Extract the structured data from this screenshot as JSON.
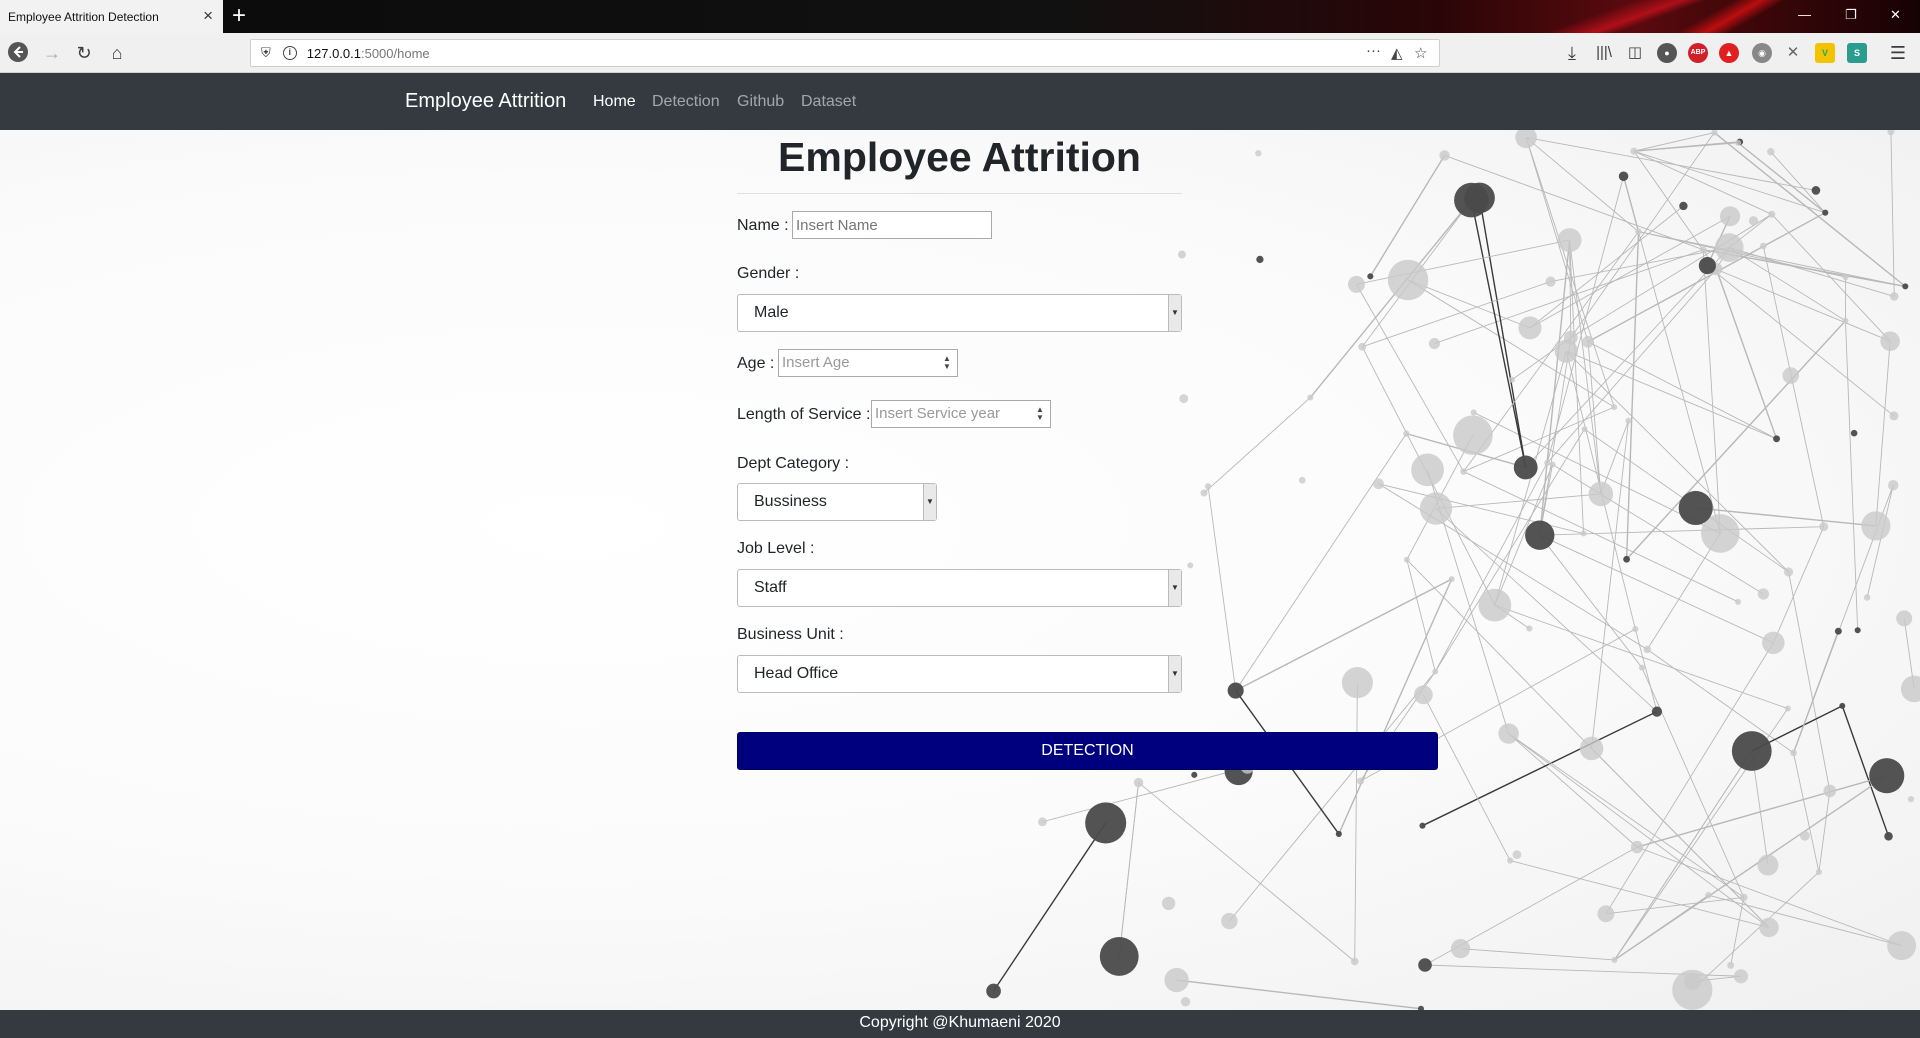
{
  "browser": {
    "tab_title": "Employee Attrition Detection",
    "tab_close": "×",
    "new_tab": "+",
    "url_host": "127.0.0.1",
    "url_path": ":5000/home",
    "icons": [
      "back-icon",
      "forward-icon",
      "reload-icon",
      "home-icon",
      "shield-icon",
      "info-icon",
      "more-icon",
      "pocket-icon",
      "bookmark-star-icon",
      "download-icon",
      "library-icon",
      "sidebar-icon",
      "account-icon",
      "adblock-icon",
      "extension-icon"
    ]
  },
  "site": {
    "brand": "Employee Attrition",
    "nav": [
      {
        "label": "Home",
        "active": true
      },
      {
        "label": "Detection",
        "active": false
      },
      {
        "label": "Github",
        "active": false
      },
      {
        "label": "Dataset",
        "active": false
      }
    ]
  },
  "form": {
    "title": "Employee Attrition",
    "name_label": "Name :",
    "name_placeholder": "Insert Name",
    "gender_label": "Gender :",
    "gender_value": "Male",
    "age_label": "Age :",
    "age_placeholder": "Insert Age",
    "service_label": "Length of Service :",
    "service_placeholder": "Insert Service year",
    "dept_label": "Dept Category :",
    "dept_value": "Bussiness",
    "job_label": "Job Level :",
    "job_value": "Staff",
    "unit_label": "Business Unit :",
    "unit_value": "Head Office",
    "submit_label": "DETECTION",
    "accent_color": "#00007f"
  },
  "footer": {
    "text": "Copyright @Khumaeni 2020"
  }
}
